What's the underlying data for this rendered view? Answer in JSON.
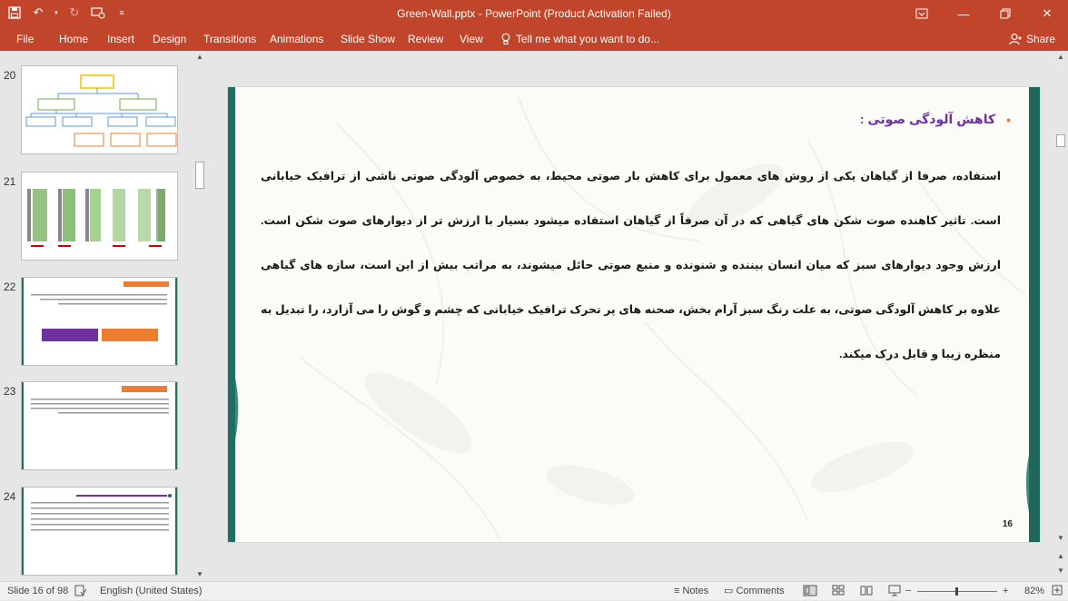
{
  "app": {
    "window_title": "Green-Wall.pptx - PowerPoint (Product Activation Failed)"
  },
  "quick_access": {
    "save_icon": "save-icon",
    "undo_icon": "undo-icon",
    "redo_icon": "redo-icon",
    "present_icon": "present-from-beginning-icon",
    "customize_icon": "customize-qat-icon"
  },
  "window_controls": {
    "ribbon_options_icon": "ribbon-display-options-icon",
    "minimize_icon": "minimize-icon",
    "restore_icon": "restore-icon",
    "close_icon": "close-icon"
  },
  "ribbon": {
    "tabs": [
      "File",
      "Home",
      "Insert",
      "Design",
      "Transitions",
      "Animations",
      "Slide Show",
      "Review",
      "View"
    ],
    "tell_me": "Tell me what you want to do...",
    "share": "Share"
  },
  "thumbnails": [
    {
      "number": "20"
    },
    {
      "number": "21"
    },
    {
      "number": "22"
    },
    {
      "number": "23"
    },
    {
      "number": "24"
    }
  ],
  "slide": {
    "heading": "کاهش آلودگی صوتی :",
    "body": "استفاده، صرفا از گیاهان یکی از روش های معمول برای کاهش بار صوتی محیط، به خصوص آلودگی صوتی ناشی از ترافیک خیابانی است. تاثیر کاهنده صوت شکن های گیاهی که در آن صرفاً از گیاهان استفاده میشود بسیار با ارزش تر از دیوارهای صوت شکن است. ارزش وجود دیوارهای سبز که میان انسان بیننده و شنونده و منبع صوتی حائل میشوند، به مراتب بیش از این است، سازه های گیاهی علاوه بر کاهش آلودگی صوتی،  به علت رنگ سبز آرام بخش، صحنه های پر تحرک ترافیک خیابانی که چشم و گوش را می آزارد، را تبدیل به منظره زیبا و قابل درک میکند.",
    "number": "16",
    "colors": {
      "heading": "#7030a0",
      "bullet": "#ed7d31",
      "side_band": "#1d675c"
    }
  },
  "status": {
    "slide_indicator": "Slide 16 of 98",
    "language": "English (United States)",
    "notes": "Notes",
    "comments": "Comments",
    "zoom": "82%"
  },
  "theme": {
    "accent": "#c0452a"
  }
}
